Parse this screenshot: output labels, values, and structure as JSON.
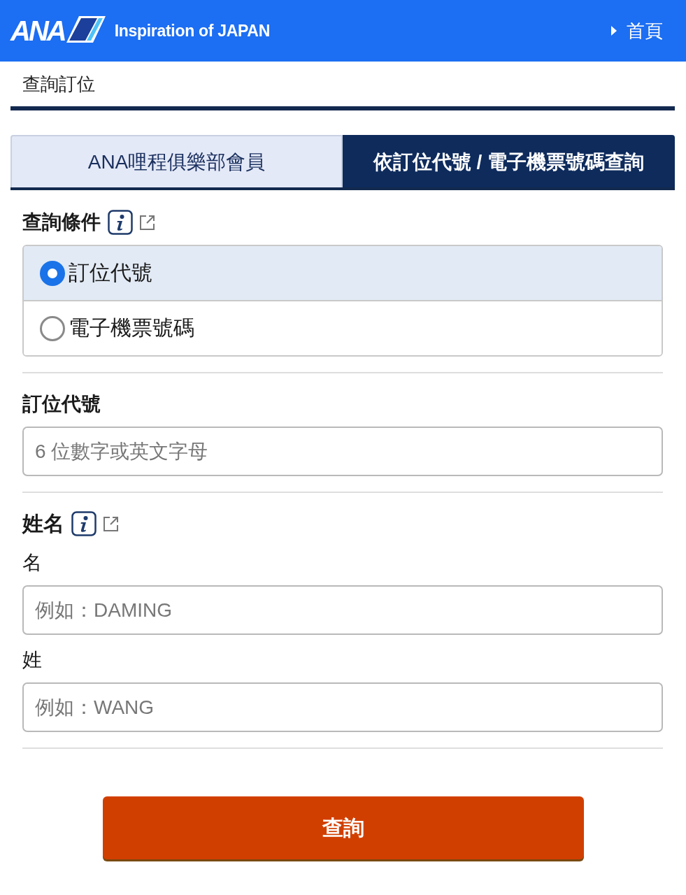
{
  "header": {
    "logo_wordmark": "ANA",
    "tagline": "Inspiration of JAPAN",
    "home_link": "首頁"
  },
  "breadcrumb": "查詢訂位",
  "tabs": [
    {
      "label": "ANA哩程俱樂部會員",
      "selected": false
    },
    {
      "label": "依訂位代號 / 電子機票號碼查詢",
      "selected": true
    }
  ],
  "search_condition": {
    "title": "查詢條件",
    "options": [
      {
        "label": "訂位代號",
        "selected": true
      },
      {
        "label": "電子機票號碼",
        "selected": false
      }
    ]
  },
  "booking_code": {
    "title": "訂位代號",
    "placeholder": "6 位數字或英文字母"
  },
  "name": {
    "title": "姓名",
    "fields": [
      {
        "label": "名",
        "placeholder": "例如：DAMING"
      },
      {
        "label": "姓",
        "placeholder": "例如：WANG"
      }
    ]
  },
  "submit_button": "查詢"
}
